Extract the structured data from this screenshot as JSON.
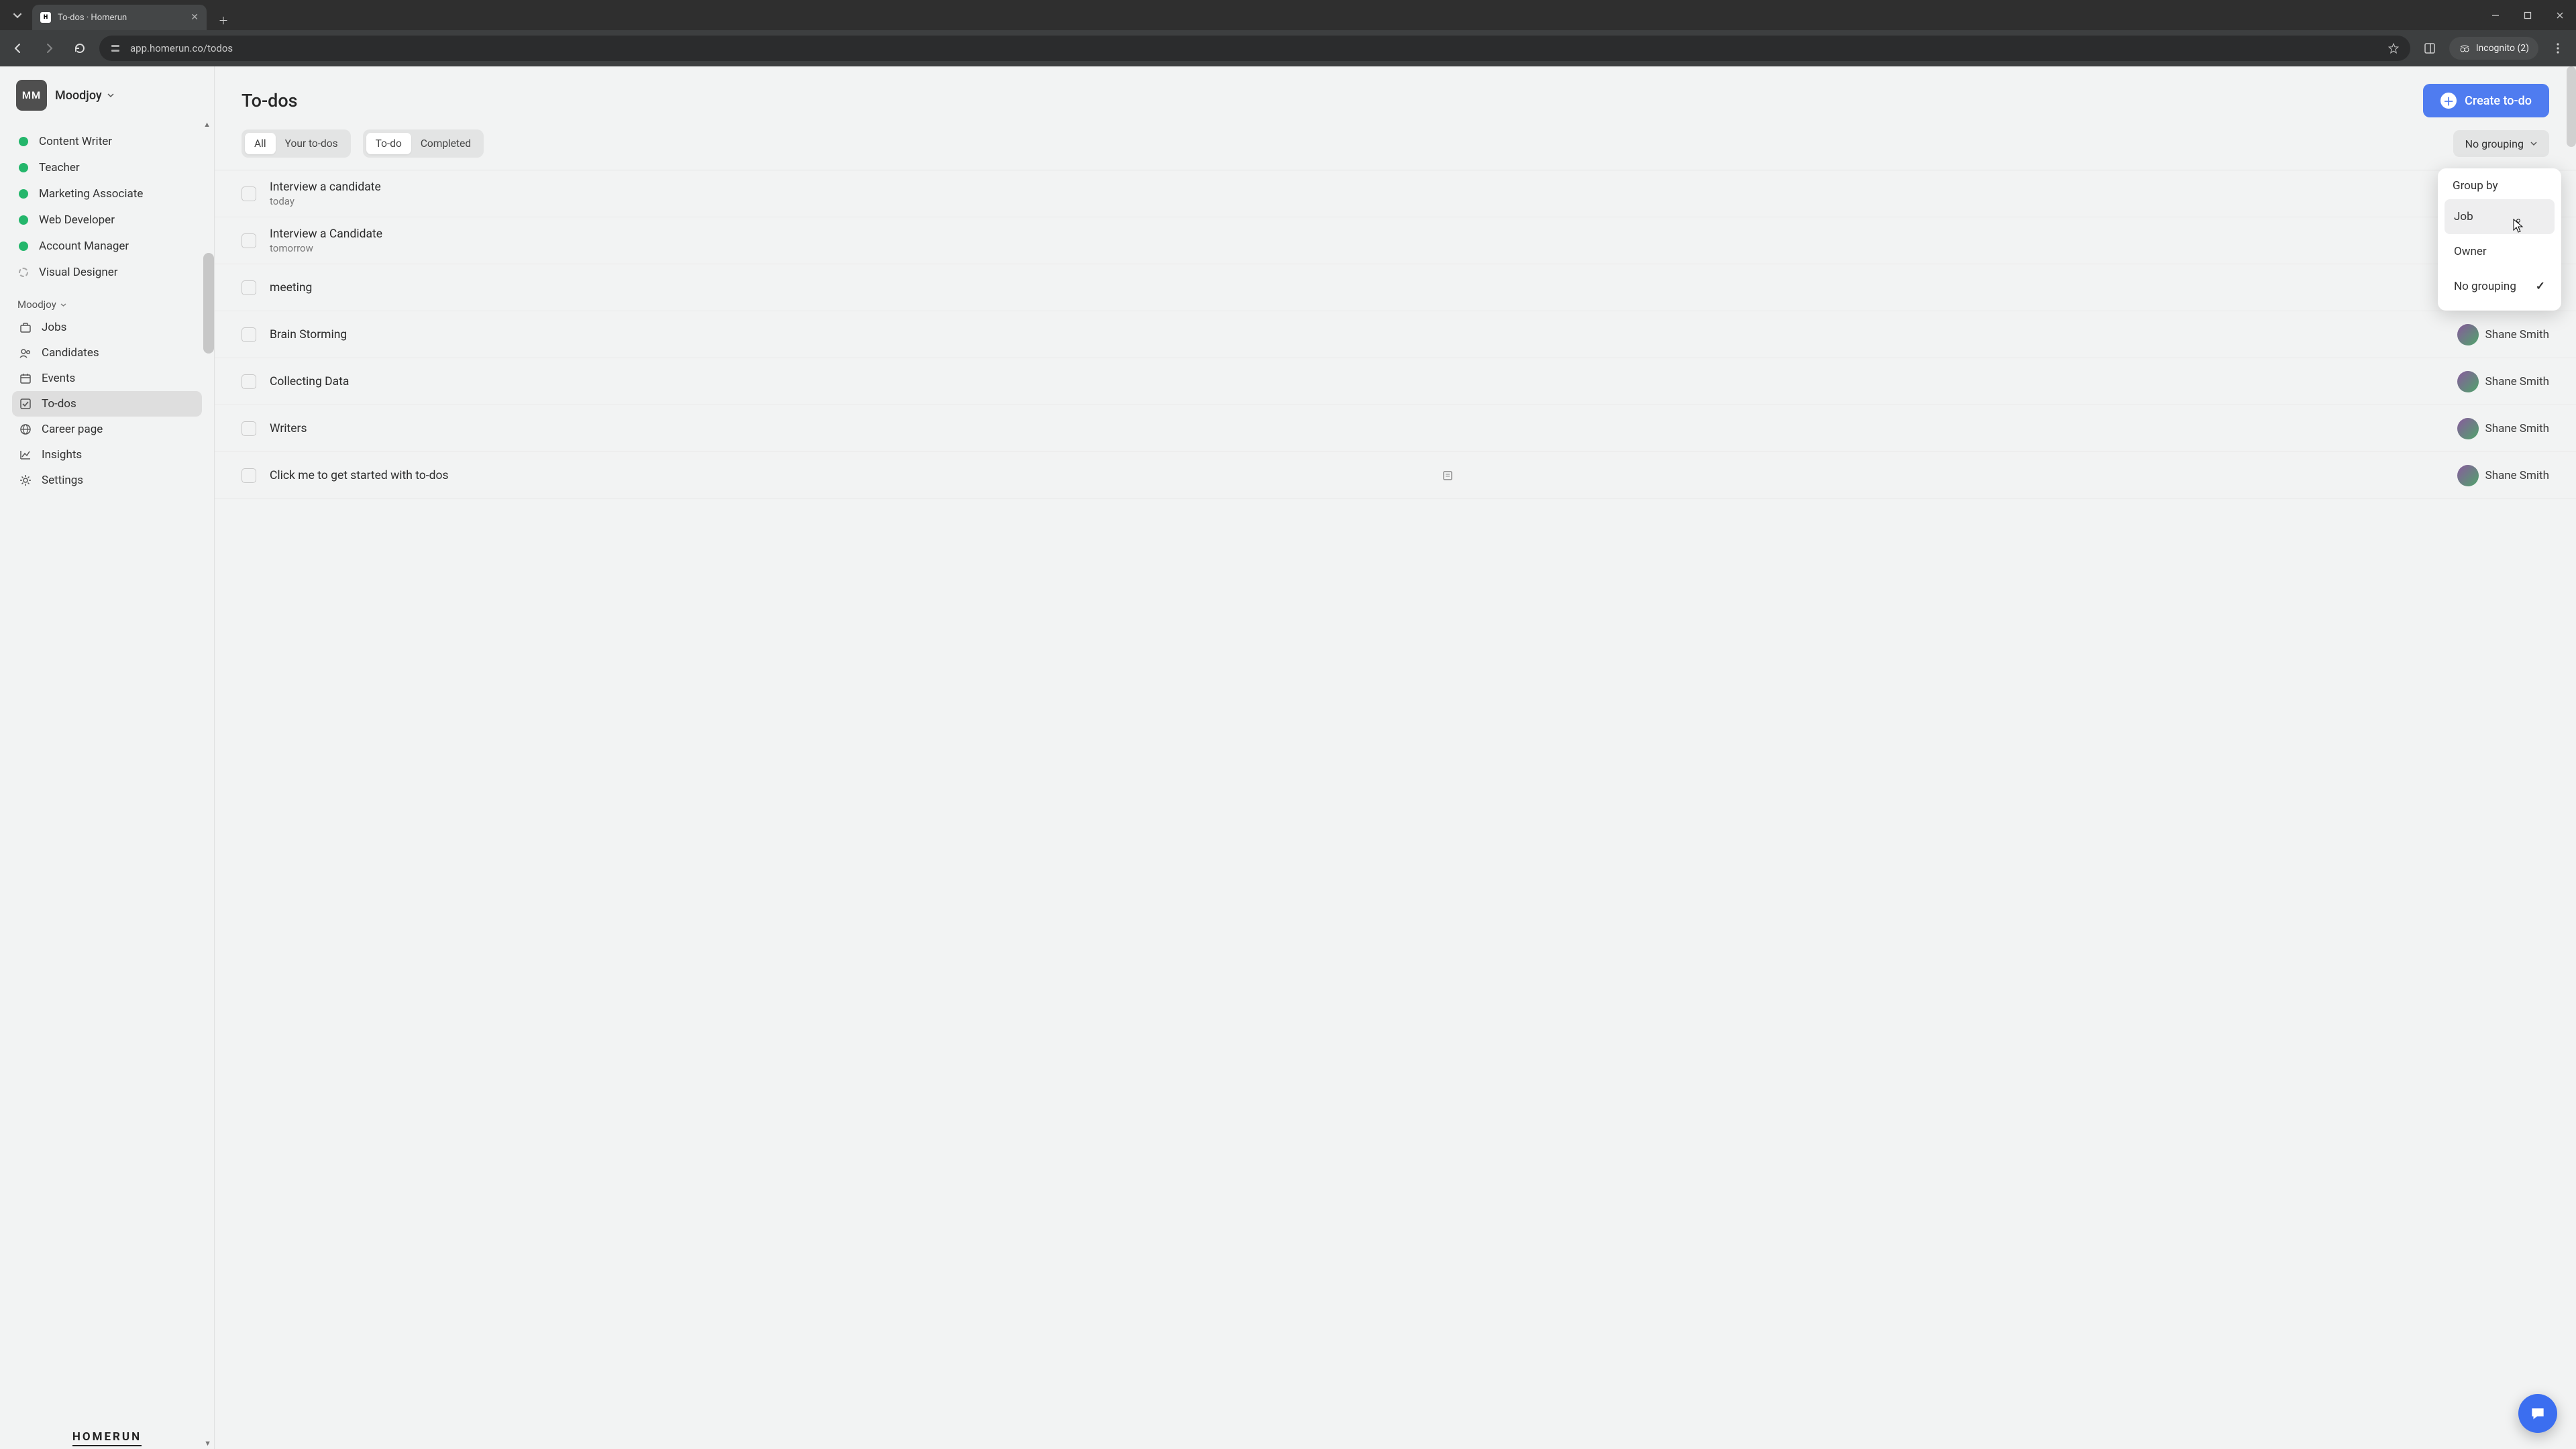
{
  "browser": {
    "tab_title": "To-dos · Homerun",
    "url": "app.homerun.co/todos",
    "incognito_label": "Incognito (2)"
  },
  "sidebar": {
    "avatar_initials": "MM",
    "org_name": "Moodjoy",
    "jobs": [
      {
        "label": "Content Writer",
        "open": true
      },
      {
        "label": "Teacher",
        "open": true
      },
      {
        "label": "Marketing Associate",
        "open": true
      },
      {
        "label": "Web Developer",
        "open": true
      },
      {
        "label": "Account Manager",
        "open": true
      },
      {
        "label": "Visual Designer",
        "open": false
      }
    ],
    "section_label": "Moodjoy",
    "nav": [
      {
        "label": "Jobs",
        "icon": "briefcase"
      },
      {
        "label": "Candidates",
        "icon": "people"
      },
      {
        "label": "Events",
        "icon": "calendar"
      },
      {
        "label": "To-dos",
        "icon": "check-square",
        "active": true
      },
      {
        "label": "Career page",
        "icon": "globe"
      },
      {
        "label": "Insights",
        "icon": "chart"
      },
      {
        "label": "Settings",
        "icon": "gear"
      }
    ],
    "product_name": "HOMERUN"
  },
  "main": {
    "title": "To-dos",
    "create_label": "Create to-do",
    "filters": {
      "owner": [
        "All",
        "Your to-dos"
      ],
      "status": [
        "To-do",
        "Completed"
      ]
    },
    "grouping_button": "No grouping",
    "dropdown": {
      "heading": "Group by",
      "items": [
        {
          "label": "Job"
        },
        {
          "label": "Owner"
        },
        {
          "label": "No grouping",
          "checked": true
        }
      ]
    },
    "todos": [
      {
        "title": "Interview a candidate",
        "sub": "today"
      },
      {
        "title": "Interview a Candidate",
        "sub": "tomorrow"
      },
      {
        "title": "meeting"
      },
      {
        "title": "Brain Storming",
        "assignee": "Shane Smith"
      },
      {
        "title": "Collecting Data",
        "assignee": "Shane Smith"
      },
      {
        "title": "Writers",
        "assignee": "Shane Smith"
      },
      {
        "title": "Click me to get started with to-dos",
        "assignee": "Shane Smith",
        "note": true
      }
    ]
  }
}
